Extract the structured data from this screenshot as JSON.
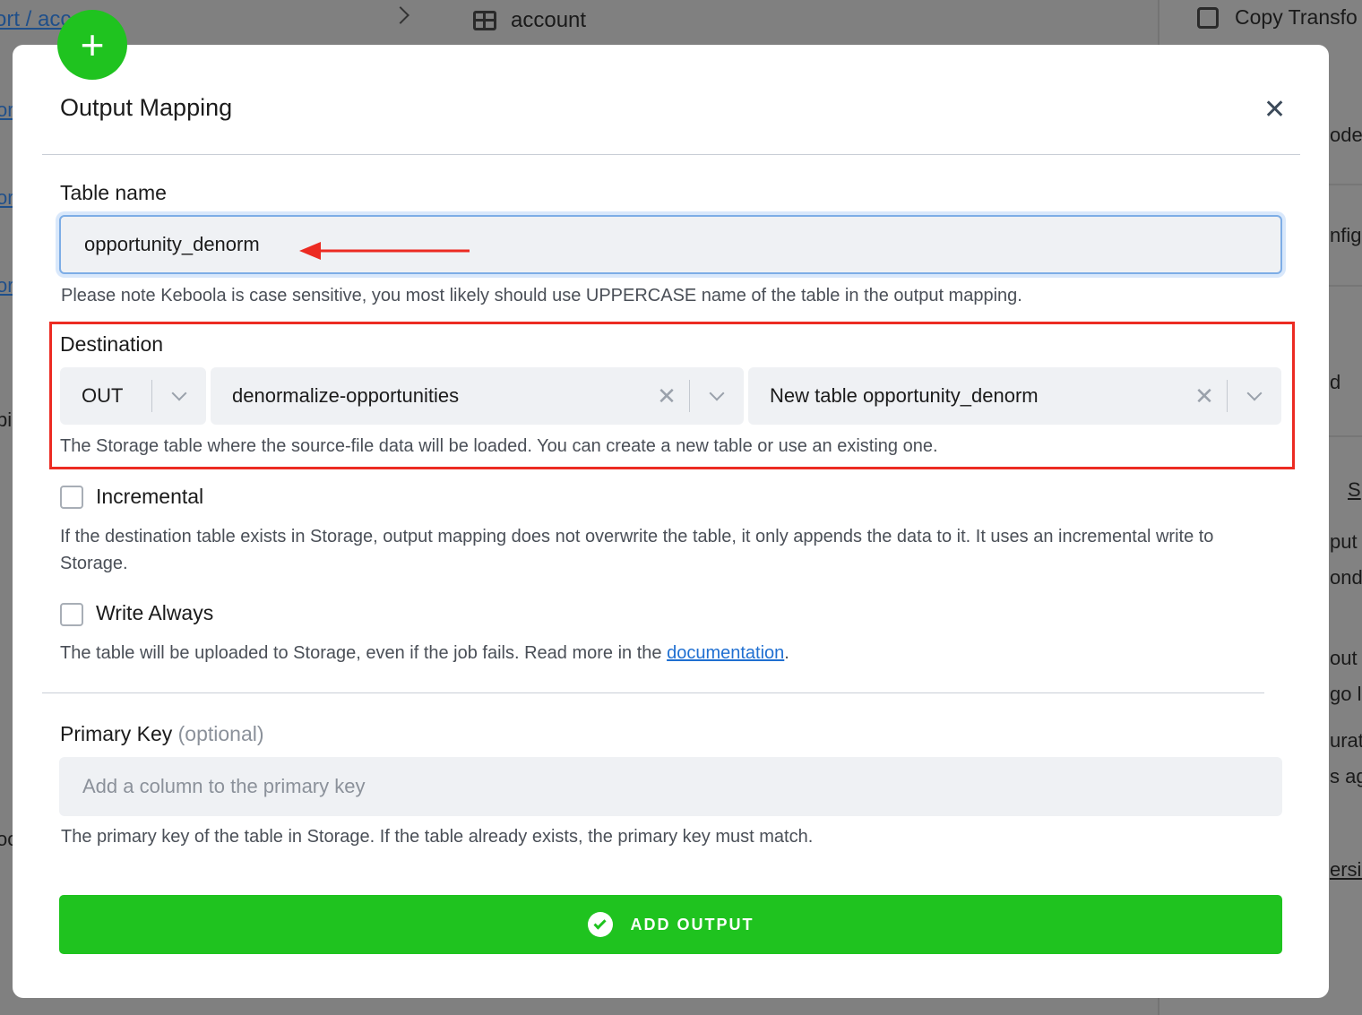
{
  "background": {
    "breadcrumb": "ort / acc",
    "tab_label": "account",
    "copy_label": "Copy Transfo",
    "right_fragments": [
      "ode",
      "nfig",
      "d",
      "S",
      "put",
      "onds",
      "out",
      "go l",
      "urat",
      "s ag",
      "ersic"
    ],
    "left_fragments": [
      "or",
      "or",
      "or",
      "pi",
      "oo"
    ]
  },
  "modal": {
    "title": "Output Mapping",
    "table_name": {
      "label": "Table name",
      "value": "opportunity_denorm",
      "help": "Please note Keboola is case sensitive, you most likely should use UPPERCASE name of the table in the output mapping."
    },
    "destination": {
      "label": "Destination",
      "stage": "OUT",
      "bucket": "denormalize-opportunities",
      "table": "New table opportunity_denorm",
      "help": "The Storage table where the source-file data will be loaded. You can create a new table or use an existing one."
    },
    "incremental": {
      "label": "Incremental",
      "help": "If the destination table exists in Storage, output mapping does not overwrite the table, it only appends the data to it. It uses an incremental write to Storage."
    },
    "write_always": {
      "label": "Write Always",
      "help_prefix": "The table will be uploaded to Storage, even if the job fails. Read more in the ",
      "link": "documentation",
      "help_suffix": "."
    },
    "primary_key": {
      "label": "Primary Key",
      "optional": "(optional)",
      "placeholder": "Add a column to the primary key",
      "help": "The primary key of the table in Storage. If the table already exists, the primary key must match."
    },
    "submit_label": "ADD OUTPUT"
  },
  "colors": {
    "accent_green": "#1fc31f",
    "highlight_red": "#ec2b22",
    "link_blue": "#1f6fd1"
  }
}
